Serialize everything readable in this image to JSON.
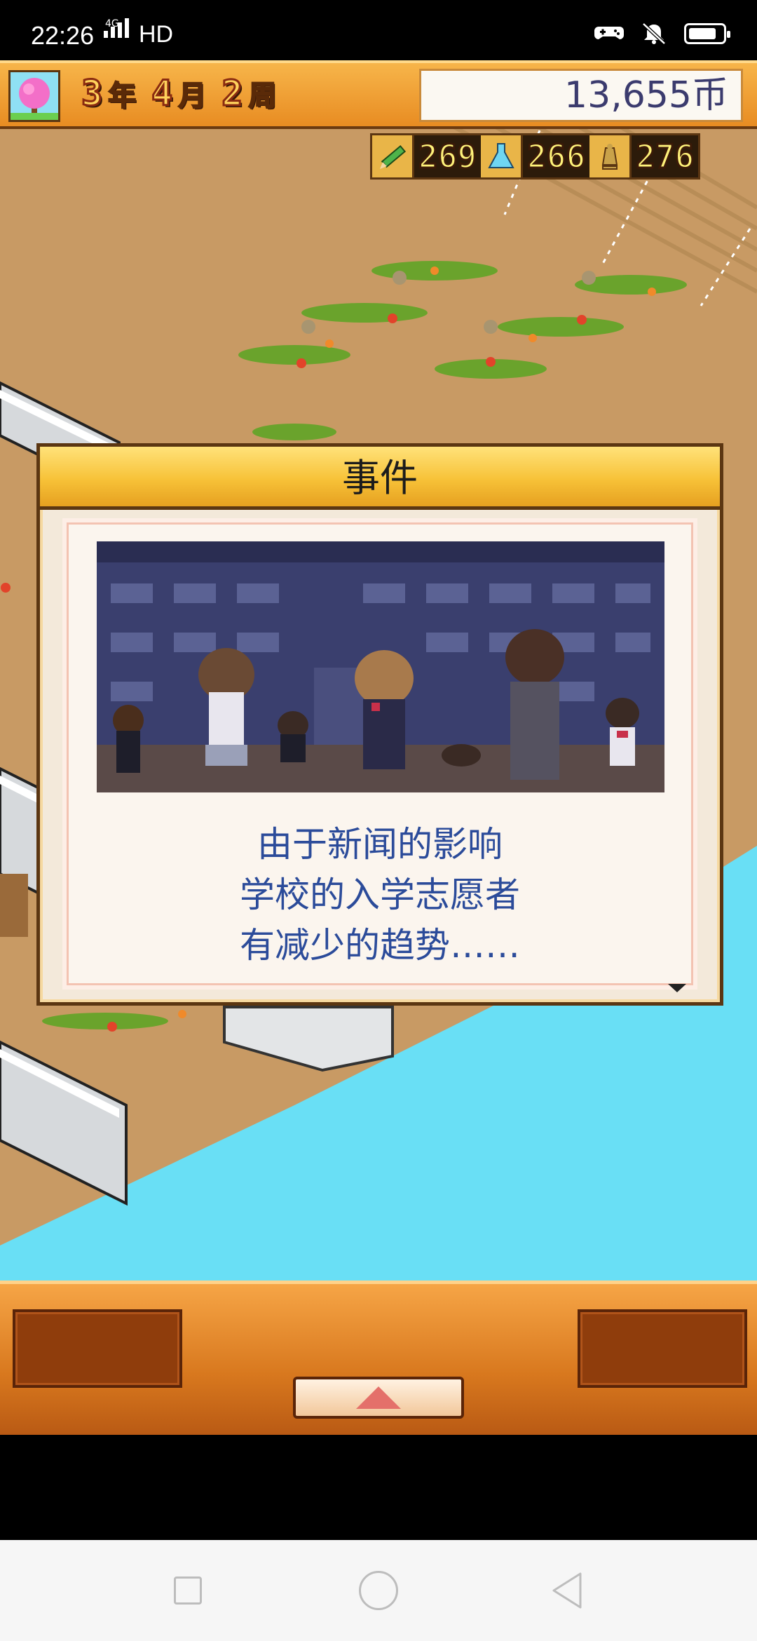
{
  "status_bar": {
    "time": "22:26",
    "network": "4G",
    "hd": "HD",
    "icons": [
      "game-controller-icon",
      "mute-bell-icon",
      "battery-icon"
    ]
  },
  "hud": {
    "year": "3",
    "year_unit": "年",
    "month": "4",
    "month_unit": "月",
    "week": "2",
    "week_unit": "周",
    "money": "13,655币",
    "avatar_icon": "pink-tree-icon"
  },
  "resources": [
    {
      "icon": "pencil-icon",
      "value": "269"
    },
    {
      "icon": "flask-icon",
      "value": "266"
    },
    {
      "icon": "trophy-icon",
      "value": "276"
    }
  ],
  "dialog": {
    "title": "事件",
    "lines": [
      "由于新闻的影响",
      "学校的入学志愿者",
      "有减少的趋势……"
    ]
  },
  "colors": {
    "hud_orange": "#f7b54a",
    "dialog_text": "#2b4b9a",
    "sea": "#69dff5",
    "ground": "#c89a64"
  }
}
